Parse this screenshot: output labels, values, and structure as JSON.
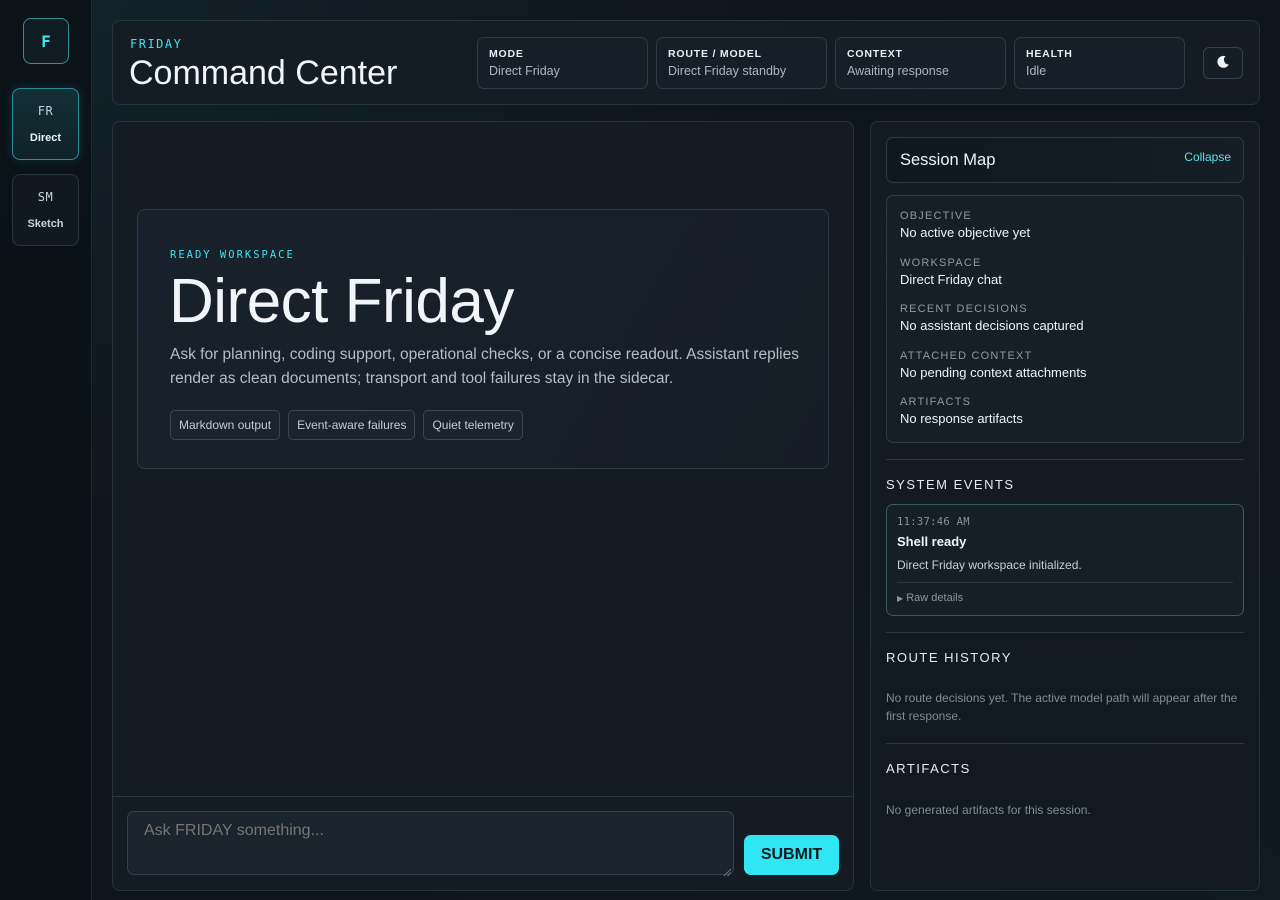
{
  "rail": {
    "logo": "F",
    "items": [
      {
        "code": "FR",
        "label": "Direct",
        "active": true
      },
      {
        "code": "SM",
        "label": "Sketch",
        "active": false
      }
    ]
  },
  "header": {
    "eyebrow": "FRIDAY",
    "title": "Command Center",
    "stats": [
      {
        "key": "MODE",
        "value": "Direct Friday"
      },
      {
        "key": "ROUTE / MODEL",
        "value": "Direct Friday standby"
      },
      {
        "key": "CONTEXT",
        "value": "Awaiting response"
      },
      {
        "key": "HEALTH",
        "value": "Idle"
      }
    ],
    "theme_icon": "moon-icon"
  },
  "hero": {
    "eyebrow": "READY WORKSPACE",
    "title": "Direct Friday",
    "description": "Ask for planning, coding support, operational checks, or a concise readout. Assistant replies render as clean documents; transport and tool failures stay in the sidecar.",
    "chips": [
      "Markdown output",
      "Event-aware failures",
      "Quiet telemetry"
    ]
  },
  "composer": {
    "placeholder": "Ask FRIDAY something...",
    "submit_label": "SUBMIT"
  },
  "session_map": {
    "title": "Session Map",
    "collapse_label": "Collapse",
    "rows": [
      {
        "key": "OBJECTIVE",
        "value": "No active objective yet"
      },
      {
        "key": "WORKSPACE",
        "value": "Direct Friday chat"
      },
      {
        "key": "RECENT DECISIONS",
        "value": "No assistant decisions captured"
      },
      {
        "key": "ATTACHED CONTEXT",
        "value": "No pending context attachments"
      },
      {
        "key": "ARTIFACTS",
        "value": "No response artifacts"
      }
    ]
  },
  "system_events": {
    "title": "SYSTEM EVENTS",
    "events": [
      {
        "time": "11:37:46 AM",
        "title": "Shell ready",
        "description": "Direct Friday workspace initialized.",
        "details_label": "Raw details"
      }
    ]
  },
  "route_history": {
    "title": "ROUTE HISTORY",
    "empty": "No route decisions yet. The active model path will appear after the first response."
  },
  "artifacts": {
    "title": "ARTIFACTS",
    "empty": "No generated artifacts for this session."
  },
  "colors": {
    "accent": "#2fe6f2",
    "background": "#0f151c",
    "panel": "#141b23"
  }
}
